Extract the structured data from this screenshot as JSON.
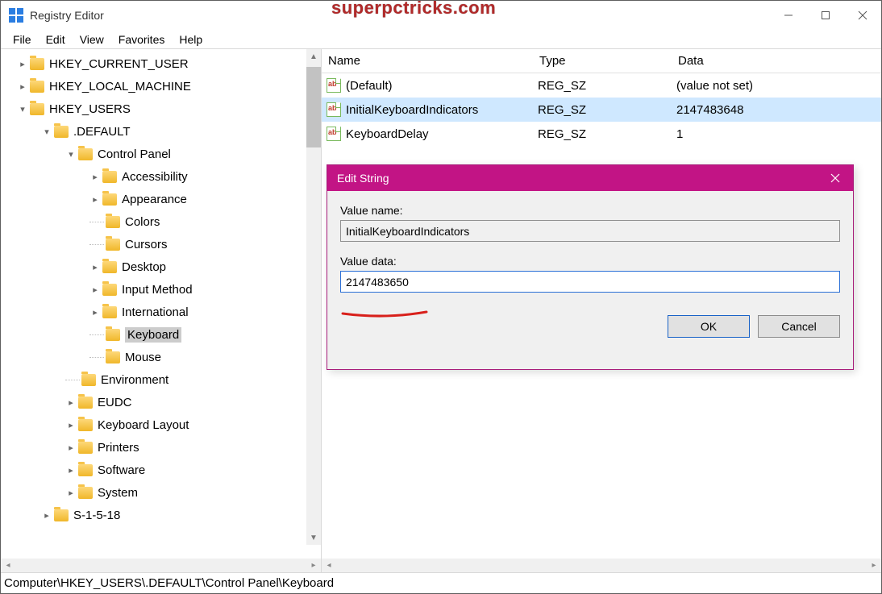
{
  "titlebar": {
    "title": "Registry Editor"
  },
  "watermark": "superpctricks.com",
  "menubar": [
    "File",
    "Edit",
    "View",
    "Favorites",
    "Help"
  ],
  "window_controls": {
    "min": "–",
    "max": "▢",
    "close": "✕"
  },
  "tree": {
    "roots": [
      "HKEY_CURRENT_USER",
      "HKEY_LOCAL_MACHINE",
      "HKEY_USERS"
    ],
    "default_node": ".DEFAULT",
    "ctrl_panel": "Control Panel",
    "cp_children": [
      "Accessibility",
      "Appearance",
      "Colors",
      "Cursors",
      "Desktop",
      "Input Method",
      "International",
      "Keyboard",
      "Mouse"
    ],
    "default_siblings": [
      "Environment",
      "EUDC",
      "Keyboard Layout",
      "Printers",
      "Software",
      "System"
    ],
    "users_sibling": "S-1-5-18",
    "selected": "Keyboard"
  },
  "list": {
    "columns": {
      "name": "Name",
      "type": "Type",
      "data": "Data"
    },
    "rows": [
      {
        "name": "(Default)",
        "type": "REG_SZ",
        "data": "(value not set)",
        "selected": false
      },
      {
        "name": "InitialKeyboardIndicators",
        "type": "REG_SZ",
        "data": "2147483648",
        "selected": true
      },
      {
        "name": "KeyboardDelay",
        "type": "REG_SZ",
        "data": "1",
        "selected": false
      }
    ],
    "icon_text": "ab"
  },
  "dialog": {
    "title": "Edit String",
    "value_name_label": "Value name:",
    "value_name": "InitialKeyboardIndicators",
    "value_data_label": "Value data:",
    "value_data": "2147483650",
    "ok": "OK",
    "cancel": "Cancel"
  },
  "statusbar": "Computer\\HKEY_USERS\\.DEFAULT\\Control Panel\\Keyboard"
}
